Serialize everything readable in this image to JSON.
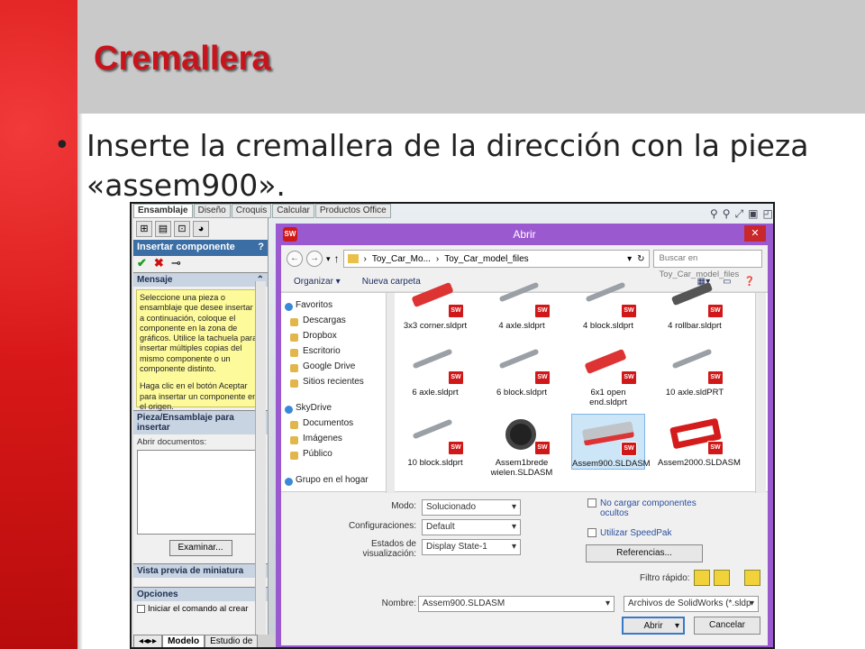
{
  "slide": {
    "title": "Cremallera",
    "bullet": "Inserte la cremallera de la dirección con la pieza «assem900».",
    "colors": {
      "red_bar": "#d81818",
      "title": "#c8141c",
      "header_band": "#c9c9c9"
    }
  },
  "solidworks": {
    "tabs": [
      "Ensamblaje",
      "Diseño",
      "Croquis",
      "Calcular",
      "Productos Office"
    ],
    "pm_title": "Insertar componente",
    "pm_help": "?",
    "pm_icons": [
      "assembly-icon",
      "properties-icon",
      "config-icon",
      "display-icon"
    ],
    "message_header": "Mensaje",
    "message_text": "Seleccione una pieza o ensamblaje que desee insertar y, a continuación, coloque el componente en la zona de gráficos. Utilice la tachuela para insertar múltiples copias del mismo componente o un componente distinto.",
    "message_text2": "Haga clic en el botón Aceptar para insertar un componente en el origen.",
    "part_section": "Pieza/Ensamblaje para insertar",
    "open_docs": "Abrir documentos:",
    "browse": "Examinar...",
    "thumb_section": "Vista previa de miniatura",
    "options_section": "Opciones",
    "start_cmd": "Iniciar el comando al crear",
    "bottom_tabs": [
      "Modelo",
      "Estudio de"
    ]
  },
  "dialog": {
    "title": "Abrir",
    "close": "✕",
    "breadcrumb": [
      "Toy_Car_Mo...",
      "Toy_Car_model_files"
    ],
    "search_placeholder": "Buscar en Toy_Car_model_files",
    "organize": "Organizar ▾",
    "new_folder": "Nueva carpeta",
    "tree": [
      {
        "label": "Favoritos",
        "lvl": 0
      },
      {
        "label": "Descargas",
        "lvl": 1
      },
      {
        "label": "Dropbox",
        "lvl": 1
      },
      {
        "label": "Escritorio",
        "lvl": 1
      },
      {
        "label": "Google Drive",
        "lvl": 1
      },
      {
        "label": "Sitios recientes",
        "lvl": 1
      },
      {
        "label": "",
        "lvl": -1
      },
      {
        "label": "SkyDrive",
        "lvl": 0
      },
      {
        "label": "Documentos",
        "lvl": 1
      },
      {
        "label": "Imágenes",
        "lvl": 1
      },
      {
        "label": "Público",
        "lvl": 1
      },
      {
        "label": "",
        "lvl": -1
      },
      {
        "label": "Grupo en el hogar",
        "lvl": 0
      }
    ],
    "files": [
      {
        "name": "3x3 corner.sldprt",
        "kind": "red",
        "selected": false
      },
      {
        "name": "4 axle.sldprt",
        "kind": "grey",
        "selected": false
      },
      {
        "name": "4 block.sldprt",
        "kind": "grey",
        "selected": false
      },
      {
        "name": "4 rollbar.sldprt",
        "kind": "dark",
        "selected": false
      },
      {
        "name": "6 axle.sldprt",
        "kind": "grey",
        "selected": false
      },
      {
        "name": "6 block.sldprt",
        "kind": "grey",
        "selected": false
      },
      {
        "name": "6x1 open end.sldprt",
        "kind": "red",
        "selected": false
      },
      {
        "name": "10 axle.sldPRT",
        "kind": "grey",
        "selected": false
      },
      {
        "name": "10 block.sldprt",
        "kind": "grey",
        "selected": false
      },
      {
        "name": "Assem1brede wielen.SLDASM",
        "kind": "wheel",
        "selected": false
      },
      {
        "name": "Assem900.SLDASM",
        "kind": "rack",
        "selected": true
      },
      {
        "name": "Assem2000.SLDASM",
        "kind": "frame",
        "selected": false
      }
    ],
    "mode_label": "Modo:",
    "mode_value": "Solucionado",
    "config_label": "Configuraciones:",
    "config_value": "Default",
    "display_label": "Estados de visualización:",
    "display_value": "Display State-1",
    "no_hidden": "No cargar componentes ocultos",
    "speedpak": "Utilizar SpeedPak",
    "references": "Referencias...",
    "quick_filter": "Filtro rápido:",
    "name_label": "Nombre:",
    "name_value": "Assem900.SLDASM",
    "filetype_value": "Archivos de SolidWorks (*.sldp",
    "open": "Abrir",
    "cancel": "Cancelar"
  }
}
